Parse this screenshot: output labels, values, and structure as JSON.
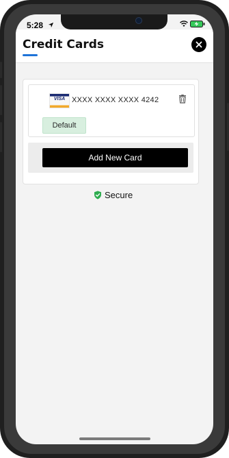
{
  "status_bar": {
    "time": "5:28",
    "icons": [
      "location-arrow-icon",
      "wifi-icon",
      "battery-charging-icon"
    ]
  },
  "header": {
    "title": "Credit Cards",
    "accent_color": "#1e73d8",
    "close_icon": "close-icon"
  },
  "cards": [
    {
      "brand": "VISA",
      "number": "XXXX XXXX XXXX 4242",
      "badge": "Default",
      "delete_icon": "trash-icon"
    }
  ],
  "actions": {
    "add_new_card": "Add New Card"
  },
  "secure": {
    "label": "Secure",
    "icon": "shield-check-icon",
    "icon_color": "#2eac4f"
  }
}
